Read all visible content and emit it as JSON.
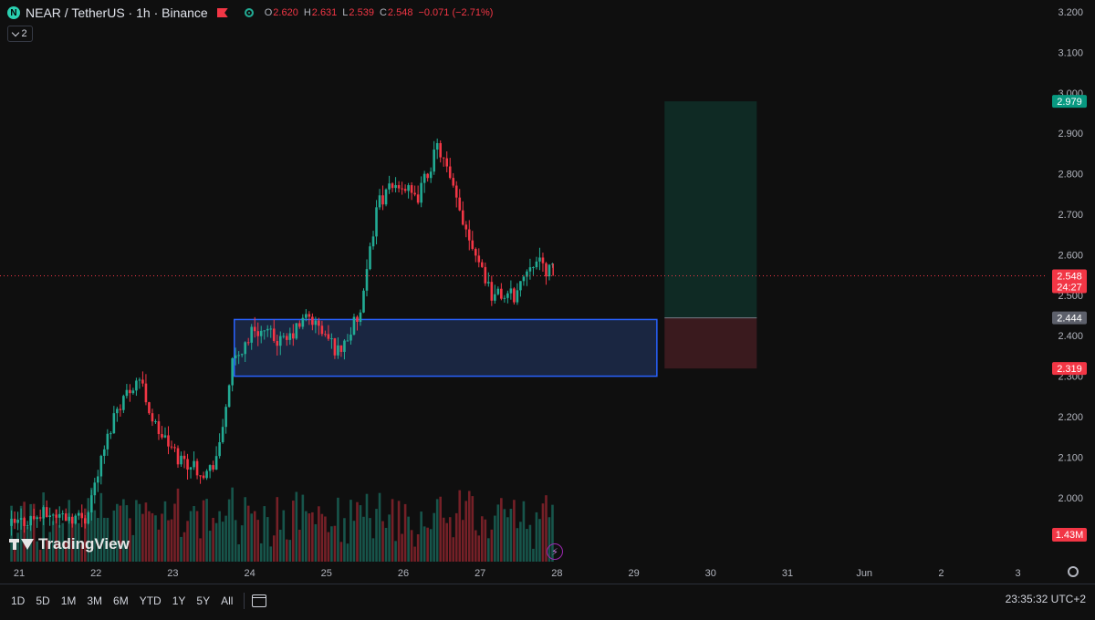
{
  "header": {
    "symbol_logo": "N",
    "symbol": "NEAR / TetherUS · 1h · Binance",
    "ohlc": {
      "o_label": "O",
      "o": "2.620",
      "h_label": "H",
      "h": "2.631",
      "l_label": "L",
      "l": "2.539",
      "c_label": "C",
      "c": "2.548",
      "change": "−0.071 (−2.71%)"
    },
    "indicator_count": "2"
  },
  "watermark": "TradingView",
  "price_axis": {
    "labels": [
      "3.200",
      "3.100",
      "3.000",
      "2.900",
      "2.800",
      "2.700",
      "2.600",
      "2.500",
      "2.400",
      "2.300",
      "2.200",
      "2.100",
      "2.000"
    ],
    "last_price": "2.548",
    "countdown": "24:27",
    "target_price": "2.979",
    "entry_price": "2.444",
    "stop_price": "2.319",
    "volume_label": "1.43M"
  },
  "time_axis": {
    "labels": [
      "21",
      "22",
      "23",
      "24",
      "25",
      "26",
      "27",
      "28",
      "29",
      "30",
      "31",
      "Jun",
      "2",
      "3"
    ]
  },
  "bottom_bar": {
    "ranges": [
      "1D",
      "5D",
      "1M",
      "3M",
      "6M",
      "YTD",
      "1Y",
      "5Y",
      "All"
    ],
    "time": "23:35:32 UTC+2"
  },
  "colors": {
    "up": "#22ab94",
    "down": "#f23645",
    "box_border": "#2962ff",
    "box_fill": "#1c2a4a",
    "target_zone": "#0f2a24",
    "stop_zone": "#3a1a1e",
    "background": "#0f0f0f"
  },
  "icons": [
    "symbol-logo-icon",
    "flag-icon",
    "live-dot-icon",
    "chevron-down-icon",
    "calendar-range-icon",
    "gear-icon",
    "lightning-icon",
    "tradingview-logo-icon"
  ],
  "chart_data": {
    "type": "candlestick",
    "interval": "1h",
    "ylim": [
      1.85,
      3.23
    ],
    "xlim": [
      "May 21",
      "Jun 3"
    ],
    "zones": [
      {
        "kind": "demand",
        "top": 2.44,
        "bottom": 2.3,
        "x_start_day": 23.8,
        "x_end_day": 29.3
      },
      {
        "kind": "long_target",
        "top": 2.979,
        "bottom": 2.444,
        "x_start_day": 29.4,
        "x_end_day": 30.6
      },
      {
        "kind": "long_stop",
        "top": 2.444,
        "bottom": 2.319,
        "x_start_day": 29.4,
        "x_end_day": 30.6
      }
    ],
    "anchors": [
      {
        "day": 20.9,
        "price": 1.93
      },
      {
        "day": 21.4,
        "price": 1.96
      },
      {
        "day": 21.9,
        "price": 1.95
      },
      {
        "day": 22.3,
        "price": 2.22
      },
      {
        "day": 22.6,
        "price": 2.3
      },
      {
        "day": 22.8,
        "price": 2.18
      },
      {
        "day": 23.1,
        "price": 2.1
      },
      {
        "day": 23.5,
        "price": 2.06
      },
      {
        "day": 23.65,
        "price": 2.12
      },
      {
        "day": 23.8,
        "price": 2.32
      },
      {
        "day": 24.1,
        "price": 2.42
      },
      {
        "day": 24.5,
        "price": 2.38
      },
      {
        "day": 24.8,
        "price": 2.45
      },
      {
        "day": 25.2,
        "price": 2.36
      },
      {
        "day": 25.5,
        "price": 2.46
      },
      {
        "day": 25.7,
        "price": 2.73
      },
      {
        "day": 26.0,
        "price": 2.78
      },
      {
        "day": 26.2,
        "price": 2.73
      },
      {
        "day": 26.5,
        "price": 2.87
      },
      {
        "day": 26.75,
        "price": 2.72
      },
      {
        "day": 27.0,
        "price": 2.6
      },
      {
        "day": 27.2,
        "price": 2.5
      },
      {
        "day": 27.5,
        "price": 2.5
      },
      {
        "day": 27.7,
        "price": 2.59
      },
      {
        "day": 27.95,
        "price": 2.56
      }
    ]
  }
}
